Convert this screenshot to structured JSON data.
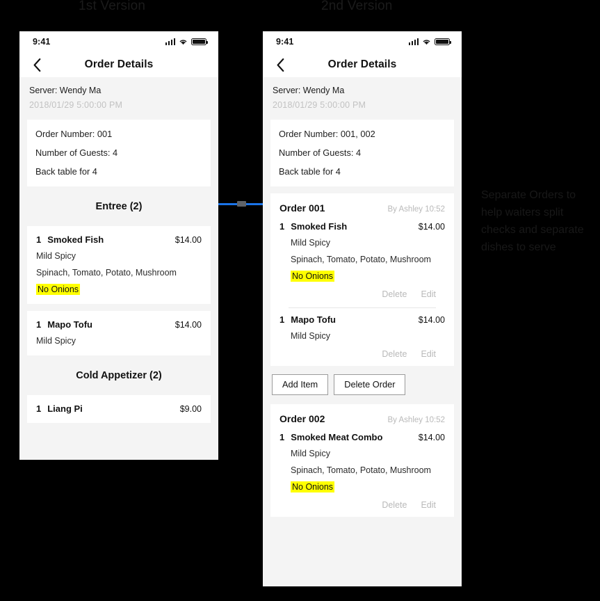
{
  "captions": {
    "version1": "1st Version",
    "version2": "2nd Version"
  },
  "annotation": {
    "text": "Separate Orders to help waiters split checks and separate dishes to serve"
  },
  "colors": {
    "background": "#000000",
    "screen_bg": "#f4f4f4",
    "card_bg": "#ffffff",
    "highlight": "#ffff00",
    "connector": "#1a73e8",
    "muted_text": "#b9b9b9"
  },
  "status_bar": {
    "time": "9:41",
    "icons": [
      "signal-icon",
      "wifi-icon",
      "battery-icon"
    ]
  },
  "nav": {
    "back_icon": "chevron-left-icon",
    "title": "Order Details"
  },
  "version1": {
    "server": {
      "name": "Server: Wendy Ma",
      "datetime": "2018/01/29  5:00:00 PM"
    },
    "order_meta": [
      "Order Number: 001",
      "Number of Guests: 4",
      "Back table for 4"
    ],
    "sections": [
      {
        "header": "Entree (2)",
        "items": [
          {
            "qty": "1",
            "name": "Smoked Fish",
            "price": "$14.00",
            "options": [
              "Mild Spicy",
              "Spinach, Tomato, Potato, Mushroom"
            ],
            "note": "No Onions"
          },
          {
            "qty": "1",
            "name": "Mapo Tofu",
            "price": "$14.00",
            "options": [
              "Mild Spicy"
            ],
            "note": ""
          }
        ]
      },
      {
        "header": "Cold Appetizer (2)",
        "items": [
          {
            "qty": "1",
            "name": "Liang Pi",
            "price": "$9.00",
            "options": [],
            "note": ""
          }
        ]
      }
    ]
  },
  "version2": {
    "server": {
      "name": "Server: Wendy Ma",
      "datetime": "2018/01/29  5:00:00 PM"
    },
    "order_meta": [
      "Order Number: 001, 002",
      "Number of Guests: 4",
      "Back table for 4"
    ],
    "row_actions": {
      "delete": "Delete",
      "edit": "Edit"
    },
    "buttons": {
      "add_item": "Add Item",
      "delete_order": "Delete Order"
    },
    "orders": [
      {
        "title": "Order 001",
        "by": "By Ashley 10:52",
        "items": [
          {
            "qty": "1",
            "name": "Smoked Fish",
            "price": "$14.00",
            "options": [
              "Mild Spicy",
              "Spinach, Tomato, Potato, Mushroom"
            ],
            "note": "No Onions"
          },
          {
            "qty": "1",
            "name": "Mapo Tofu",
            "price": "$14.00",
            "options": [
              "Mild Spicy"
            ],
            "note": ""
          }
        ]
      },
      {
        "title": "Order 002",
        "by": "By Ashley 10:52",
        "items": [
          {
            "qty": "1",
            "name": "Smoked Meat Combo",
            "price": "$14.00",
            "options": [
              "Mild Spicy",
              "Spinach, Tomato, Potato, Mushroom"
            ],
            "note": "No Onions"
          }
        ]
      }
    ]
  }
}
